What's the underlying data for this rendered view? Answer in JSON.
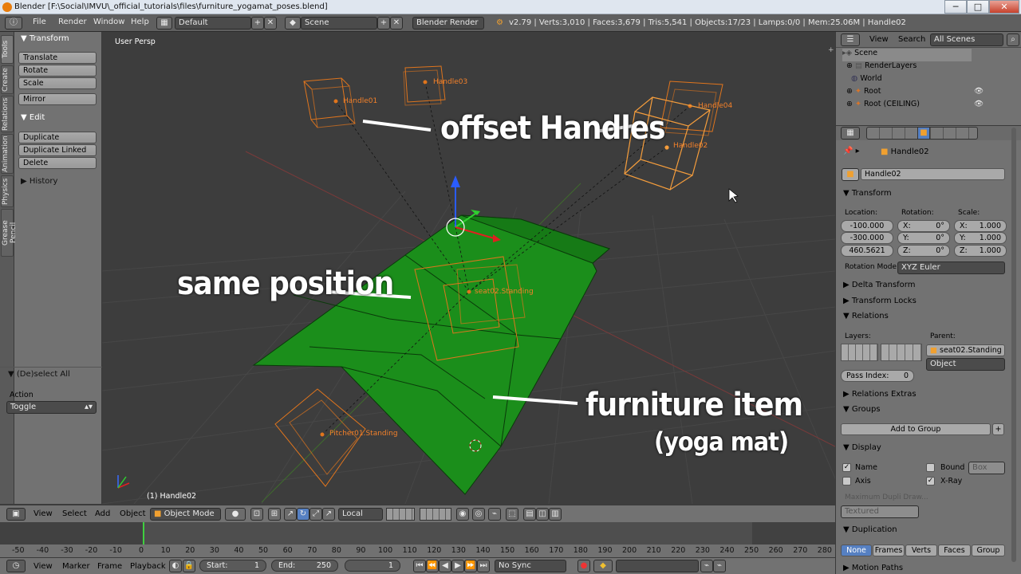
{
  "window": {
    "title": "Blender [F:\\Social\\IMVU\\_official_tutorials\\files\\furniture_yogamat_poses.blend]",
    "min": "─",
    "max": "□",
    "close": "✕"
  },
  "info_header": {
    "menus": [
      "File",
      "Render",
      "Window",
      "Help"
    ],
    "layout": "Default",
    "scene": "Scene",
    "engine": "Blender Render",
    "stats": "v2.79 | Verts:3,010 | Faces:3,679 | Tris:5,541 | Objects:17/23 | Lamps:0/0 | Mem:25.06M | Handle02"
  },
  "tool_shelf": {
    "tabs": [
      "Tools",
      "Create",
      "Relations",
      "Animation",
      "Physics",
      "Grease Pencil"
    ],
    "transform_title": "Transform",
    "transform_buttons": [
      "Translate",
      "Rotate",
      "Scale"
    ],
    "mirror": "Mirror",
    "edit_title": "Edit",
    "edit_buttons": [
      "Duplicate",
      "Duplicate Linked",
      "Delete"
    ],
    "history_title": "History",
    "operator_title": "(De)select All",
    "action_label": "Action",
    "action_value": "Toggle"
  },
  "viewport": {
    "view_label": "User Persp",
    "selected_label": "(1) Handle02",
    "handles": [
      "Handle01",
      "Handle03",
      "Handle04",
      "Handle02",
      "Pitcher01.Standing",
      "seat02.Standing"
    ],
    "annotations": {
      "offset": "offset Handles",
      "same": "same position",
      "furniture": "furniture item",
      "yoga": "(yoga mat)"
    },
    "colors": {
      "mat": "#1b8e1b",
      "handle": "#e0751d",
      "selected": "#f59d3c"
    }
  },
  "view3d_header": {
    "menus": [
      "View",
      "Select",
      "Add",
      "Object"
    ],
    "mode": "Object Mode",
    "orientation": "Local"
  },
  "timeline": {
    "ticks": [
      "-50",
      "-40",
      "-30",
      "-20",
      "-10",
      "0",
      "10",
      "20",
      "30",
      "40",
      "50",
      "60",
      "70",
      "80",
      "90",
      "100",
      "110",
      "120",
      "130",
      "140",
      "150",
      "160",
      "170",
      "180",
      "190",
      "200",
      "210",
      "220",
      "230",
      "240",
      "250",
      "260",
      "270",
      "280"
    ],
    "menus": [
      "View",
      "Marker",
      "Frame",
      "Playback"
    ],
    "start_label": "Start:",
    "start": "1",
    "end_label": "End:",
    "end": "250",
    "current": "1",
    "sync": "No Sync"
  },
  "outliner": {
    "menus": [
      "View",
      "Search"
    ],
    "filter": "All Scenes",
    "rows": [
      "Scene",
      "RenderLayers",
      "World",
      "Root",
      "Root (CEILING)"
    ]
  },
  "properties": {
    "object_path": "Handle02",
    "object_name": "Handle02",
    "transform_title": "Transform",
    "location_label": "Location:",
    "rotation_label": "Rotation:",
    "scale_label": "Scale:",
    "location": [
      "-100.000",
      "-300.000",
      "460.5621"
    ],
    "rotation": [
      "X:",
      "0°",
      "Y:",
      "0°",
      "Z:",
      "0°"
    ],
    "scale": [
      "X:",
      "1.000",
      "Y:",
      "1.000",
      "Z:",
      "1.000"
    ],
    "rotation_mode_label": "Rotation Mode:",
    "rotation_mode": "XYZ Euler",
    "delta": "Delta Transform",
    "locks": "Transform Locks",
    "relations": "Relations",
    "layers_label": "Layers:",
    "parent_label": "Parent:",
    "parent": "seat02.Standing",
    "parent_type": "Object",
    "pass_index_label": "Pass Index:",
    "pass_index": "0",
    "relations_extras": "Relations Extras",
    "groups": "Groups",
    "add_to_group": "Add to Group",
    "display": "Display",
    "name": "Name",
    "bound": "Bound",
    "bound_type": "Box",
    "axis": "Axis",
    "xray": "X-Ray",
    "max_dupli": "Maximum Dupli Draw...",
    "textured": "Textured",
    "duplication": "Duplication",
    "dup_options": [
      "None",
      "Frames",
      "Verts",
      "Faces",
      "Group"
    ],
    "motion_paths": "Motion Paths"
  }
}
